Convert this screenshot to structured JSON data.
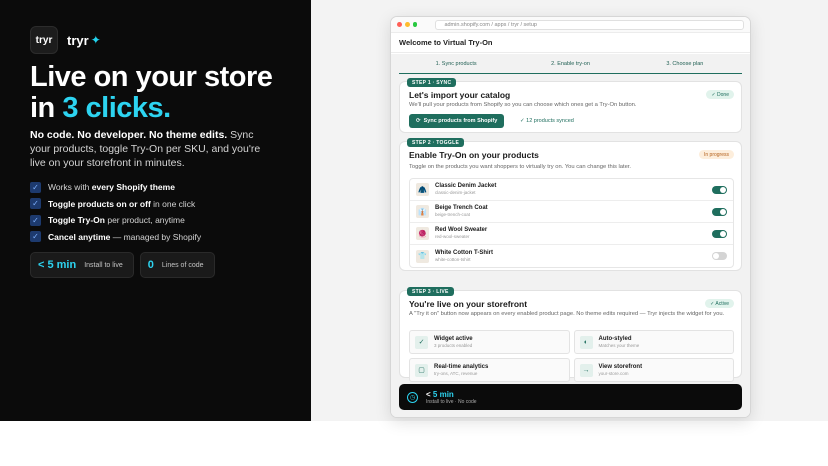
{
  "brand": {
    "logo_text": "tryr",
    "name": "tryr",
    "spark": "✦"
  },
  "hero": {
    "line1": "Live on your store",
    "line2_prefix": "in ",
    "line2_accent": "3 clicks."
  },
  "sub": {
    "bold": "No code. No developer. No theme edits.",
    "rest": " Sync your products, toggle Try-On per SKU, and you're live on your storefront in minutes."
  },
  "features": [
    {
      "pre": "Works with ",
      "bold": "every Shopify theme",
      "post": ""
    },
    {
      "pre": "",
      "bold": "Toggle products on or off",
      "post": " in one click"
    },
    {
      "pre": "",
      "bold": "Toggle Try-On",
      "post": " per product, anytime"
    },
    {
      "pre": "",
      "bold": "Cancel anytime",
      "post": " — managed by Shopify"
    }
  ],
  "stats": [
    {
      "value": "< 5 min",
      "label": "Install to live"
    },
    {
      "value": "0",
      "label": "Lines of code"
    }
  ],
  "window": {
    "url": "admin.shopify.com / apps / tryr / setup",
    "title": "Welcome to Virtual Try-On",
    "steps": [
      "1. Sync products",
      "2. Enable try-on",
      "3. Choose plan"
    ]
  },
  "step1": {
    "tag": "STEP 1 · SYNC",
    "title": "Let's import your catalog",
    "desc": "We'll pull your products from Shopify so you can choose which ones get a Try-On button.",
    "badge": "✓ Done",
    "button": "Sync products from Shopify",
    "synced": "✓ 12 products synced"
  },
  "step2": {
    "tag": "STEP 2 · TOGGLE",
    "title": "Enable Try-On on your products",
    "desc": "Toggle on the products you want shoppers to virtually try on. You can change this later.",
    "badge": "In progress",
    "products": [
      {
        "name": "Classic Denim Jacket",
        "sku": "classic-denim-jacket",
        "on": true,
        "icon": "jacket-icon",
        "glyph": "🧥"
      },
      {
        "name": "Beige Trench Coat",
        "sku": "beige-trench-coat",
        "on": true,
        "icon": "coat-icon",
        "glyph": "👔"
      },
      {
        "name": "Red Wool Sweater",
        "sku": "red-wool-sweater",
        "on": true,
        "icon": "sweater-icon",
        "glyph": "🧶"
      },
      {
        "name": "White Cotton T-Shirt",
        "sku": "white-cotton-tshirt",
        "on": false,
        "icon": "tshirt-icon",
        "glyph": "👕"
      }
    ]
  },
  "step3": {
    "tag": "STEP 3 · LIVE",
    "title": "You're live on your storefront",
    "desc": "A \"Try it on\" button now appears on every enabled product page. No theme edits required — Tryr injects the widget for you.",
    "badge": "✓ Active",
    "tiles": [
      {
        "name": "Widget active",
        "sub": "3 products enabled",
        "icon": "check-icon",
        "glyph": "✓"
      },
      {
        "name": "Auto-styled",
        "sub": "Matches your theme",
        "icon": "palette-icon",
        "glyph": "◐"
      },
      {
        "name": "Real-time analytics",
        "sub": "try-ons, ATC, revenue",
        "icon": "chat-icon",
        "glyph": "▢"
      },
      {
        "name": "View storefront",
        "sub": "your-store.com",
        "icon": "arrow-right-icon",
        "glyph": "→"
      }
    ]
  },
  "footer": {
    "value_prefix": "< ",
    "value_accent": "5 min",
    "label": "Install to live · No code"
  },
  "colors": {
    "accent": "#2dd4f1",
    "brand_green": "#1f6e5e",
    "dark": "#0b0b0b"
  }
}
